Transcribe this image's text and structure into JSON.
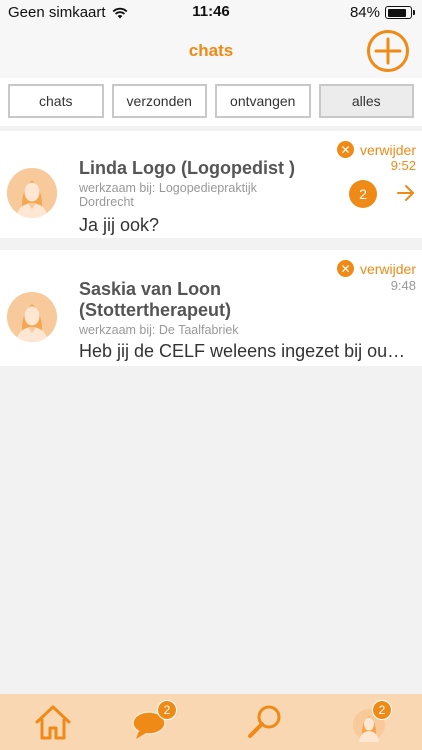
{
  "status_bar": {
    "carrier": "Geen simkaart",
    "time": "11:46",
    "battery": "84%",
    "battery_level": 0.84
  },
  "header": {
    "title": "chats",
    "add_icon": "plus-circle-icon"
  },
  "tabs": [
    {
      "label": "chats",
      "active": false
    },
    {
      "label": "verzonden",
      "active": false
    },
    {
      "label": "ontvangen",
      "active": false
    },
    {
      "label": "alles",
      "active": true
    }
  ],
  "chats": [
    {
      "name": "Linda Logo (Logopedist )",
      "workplace": "werkzaam bij: Logopediepraktijk Dordrecht",
      "message": "Ja jij ook?",
      "delete_label": "verwijder",
      "time": "9:52",
      "unread_count": "2"
    },
    {
      "name": "Saskia van Loon (Stottertherapeut)",
      "workplace": "werkzaam bij: De Taalfabriek",
      "message": "Heb jij de CELF weleens ingezet bij oudere kinderen?",
      "delete_label": "verwijder",
      "time": "9:48"
    }
  ],
  "bottom_nav": {
    "items": [
      {
        "icon": "home-icon"
      },
      {
        "icon": "chat-bubble-icon",
        "badge": "2"
      },
      {
        "icon": "search-icon"
      },
      {
        "icon": "profile-icon",
        "badge": "2"
      }
    ]
  },
  "colors": {
    "accent": "#ef8a16",
    "nav_background": "#fad7b3",
    "avatar_background": "#f8c99a"
  }
}
